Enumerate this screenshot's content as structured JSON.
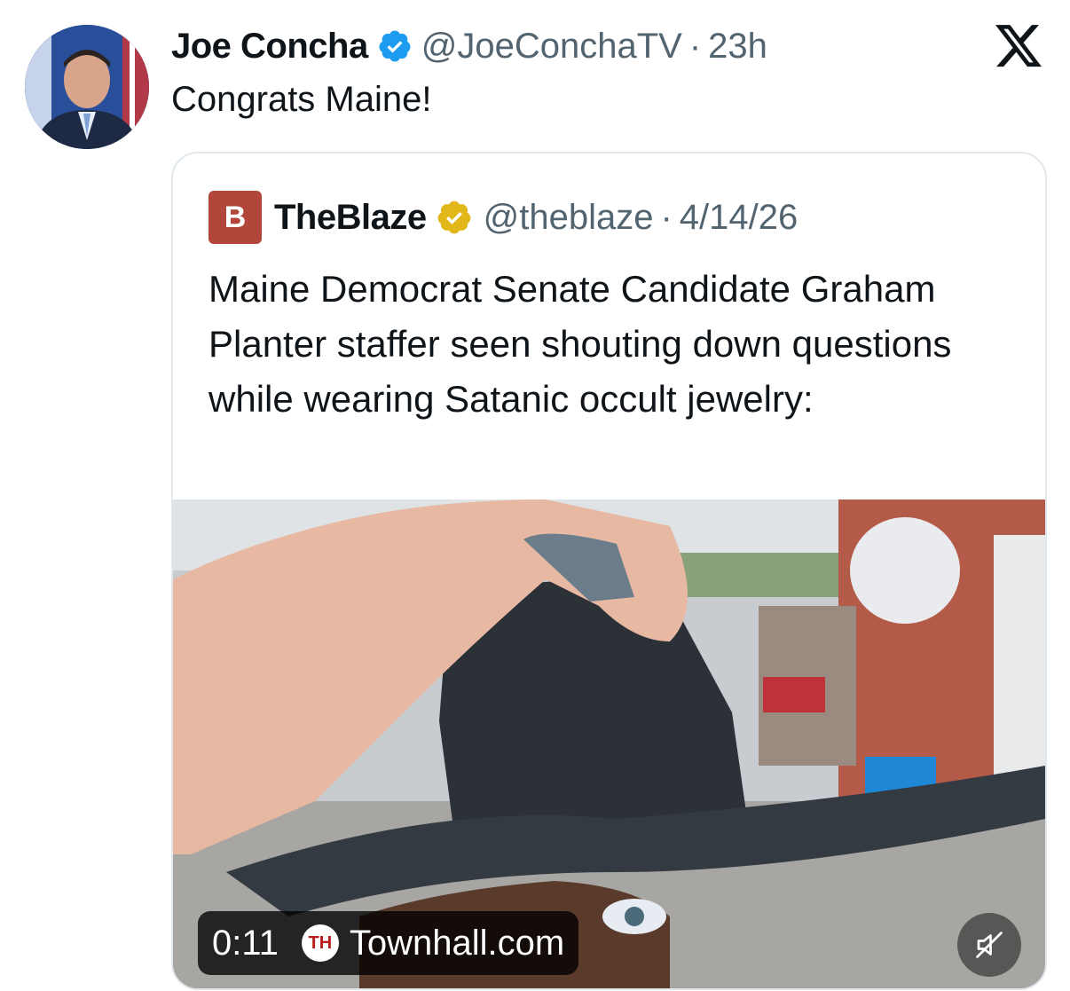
{
  "tweet": {
    "author_name": "Joe Concha",
    "handle": "@JoeConchaTV",
    "separator": "·",
    "time": "23h",
    "text": "Congrats Maine!",
    "avatar_icon": "avatar-photo",
    "verified_color": "#1d9bf0"
  },
  "quoted": {
    "logo_letter": "B",
    "author_name": "TheBlaze",
    "handle": "@theblaze",
    "separator": "·",
    "date": "4/14/26",
    "text": "Maine Democrat Senate Candidate Graham Planter staffer seen shouting down questions while wearing Satanic occult jewelry:",
    "verified_color": "#e2b719",
    "logo_color": "#b0473a"
  },
  "video": {
    "duration": "0:11",
    "source_logo": "TH",
    "source": "Townhall.com",
    "mute_icon": "speaker-muted-icon"
  },
  "app": {
    "logo_icon": "x-logo-icon"
  }
}
